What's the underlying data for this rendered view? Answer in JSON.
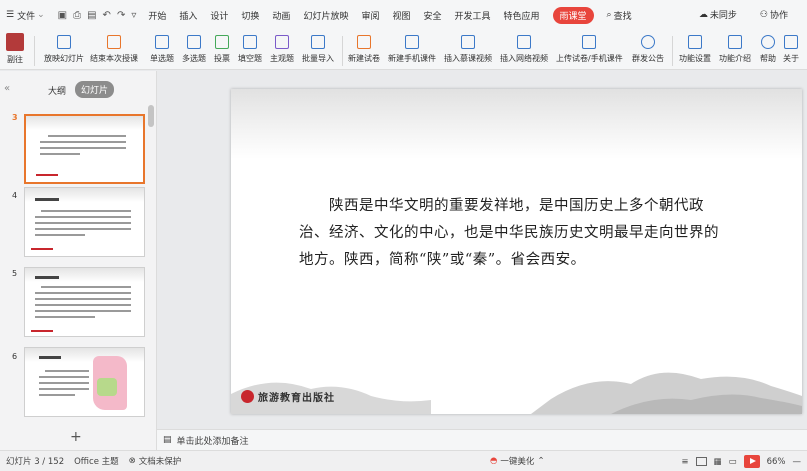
{
  "menu": {
    "file_label": "文件",
    "tabs": [
      "开始",
      "插入",
      "设计",
      "切换",
      "动画",
      "幻灯片放映",
      "审阅",
      "视图",
      "安全",
      "开发工具",
      "特色应用"
    ],
    "active_tab": "雨课堂",
    "search_label": "查找",
    "sync_label": "未同步",
    "collab_label": "协作"
  },
  "ribbon": {
    "items": [
      "副往",
      "放映幻灯片",
      "结束本次授课",
      "单选题",
      "多选题",
      "投票",
      "填空题",
      "主观题",
      "批量导入",
      "新建试卷",
      "新建手机课件",
      "插入慕课视频",
      "插入网络视频",
      "上传试卷/手机课件",
      "群发公告",
      "功能设置",
      "功能介绍",
      "帮助",
      "关于"
    ]
  },
  "left_panel": {
    "tab_outline": "大纲",
    "tab_slides": "幻灯片",
    "slide_numbers": [
      "3",
      "4",
      "5",
      "6"
    ]
  },
  "slide": {
    "body_text": "陕西是中华文明的重要发祥地，是中国历史上多个朝代政治、经济、文化的中心，也是中华民族历史文明最早走向世界的地方。陕西，简称“陕”或“秦”。省会西安。",
    "publisher": "旅游教育出版社"
  },
  "notes": {
    "placeholder": "单击此处添加备注"
  },
  "status": {
    "slide_counter": "幻灯片 3 / 152",
    "theme": "Office 主题",
    "protection": "文档未保护",
    "beautify": "一键美化",
    "zoom": "66%"
  },
  "colors": {
    "accent": "#e8453c",
    "selection": "#e8762c"
  }
}
